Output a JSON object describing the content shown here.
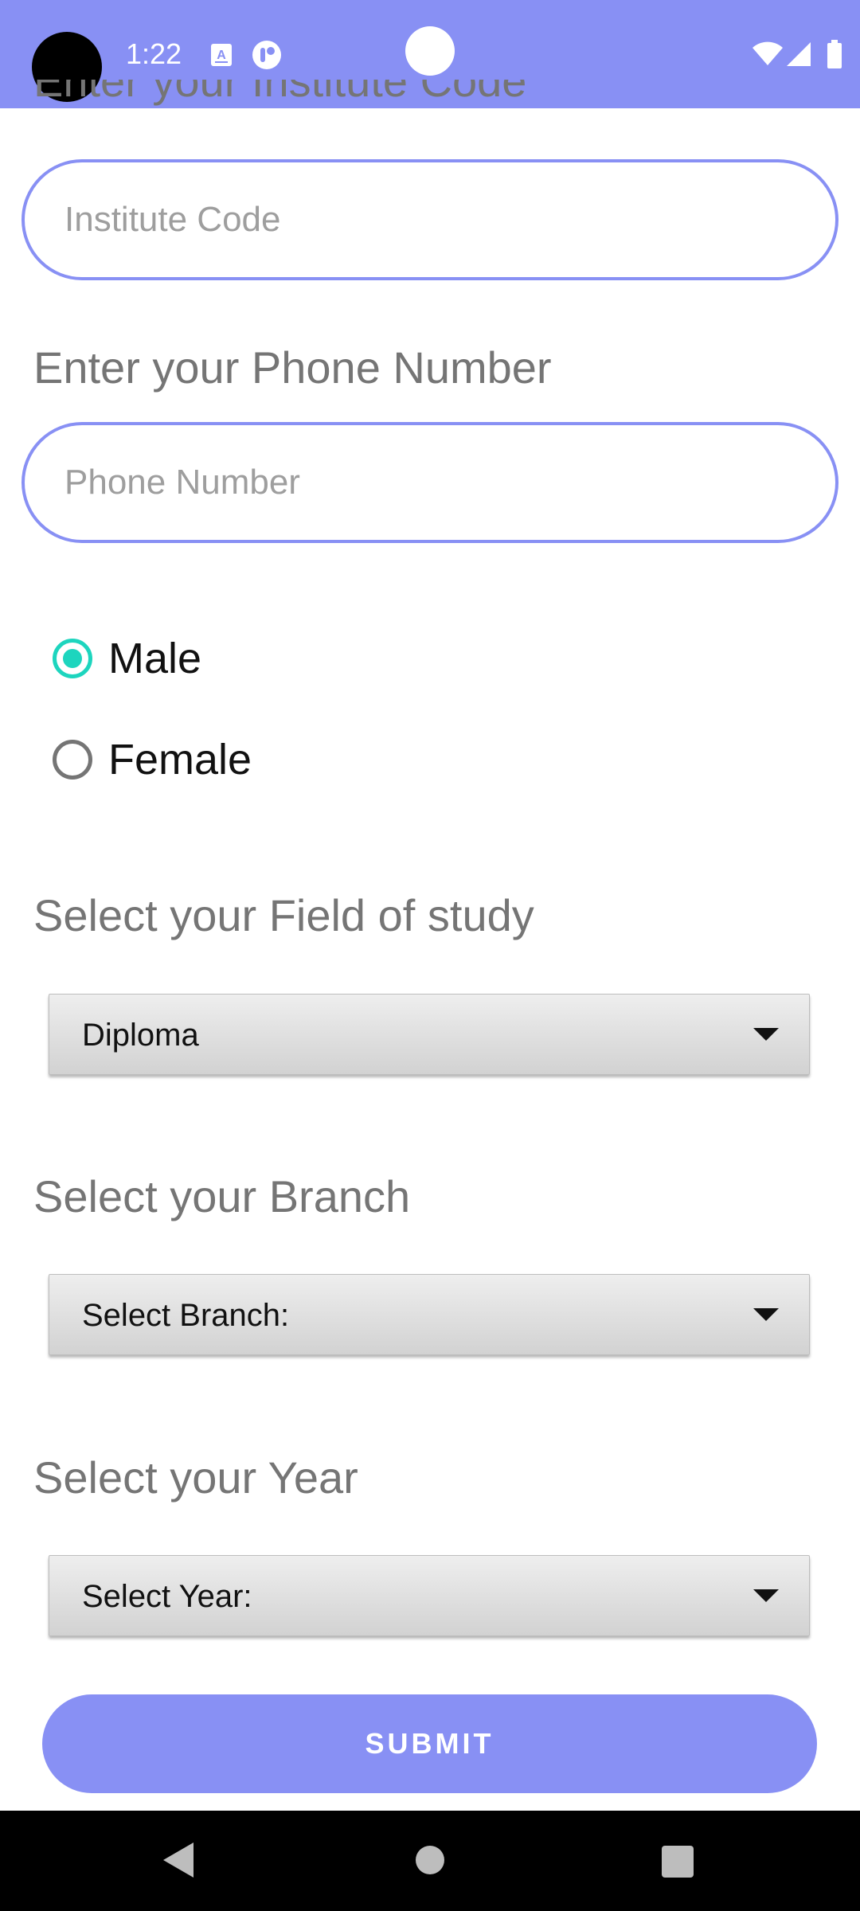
{
  "status_bar": {
    "time": "1:22",
    "icons": [
      "camera-cutout",
      "font-notification-icon",
      "app-notification-icon",
      "wifi-icon",
      "signal-icon",
      "battery-icon"
    ],
    "background_color": "#8890F4"
  },
  "form": {
    "institute_label": "Enter your Institute Code",
    "institute_placeholder": "Institute Code",
    "phone_label": "Enter your Phone Number",
    "phone_placeholder": "Phone Number",
    "gender_options": [
      {
        "label": "Male",
        "selected": true
      },
      {
        "label": "Female",
        "selected": false
      }
    ],
    "field_label": "Select your Field of study",
    "field_value": "Diploma",
    "branch_label": "Select your Branch",
    "branch_value": "Select Branch:",
    "year_label": "Select your Year",
    "year_value": "Select Year:",
    "submit_label": "SUBMIT"
  },
  "colors": {
    "accent": "#8890F4",
    "radio_selected": "#1DD5BE",
    "label_text": "#757575"
  },
  "nav_bar": {
    "icons": [
      "back-icon",
      "home-icon",
      "recents-icon"
    ]
  }
}
